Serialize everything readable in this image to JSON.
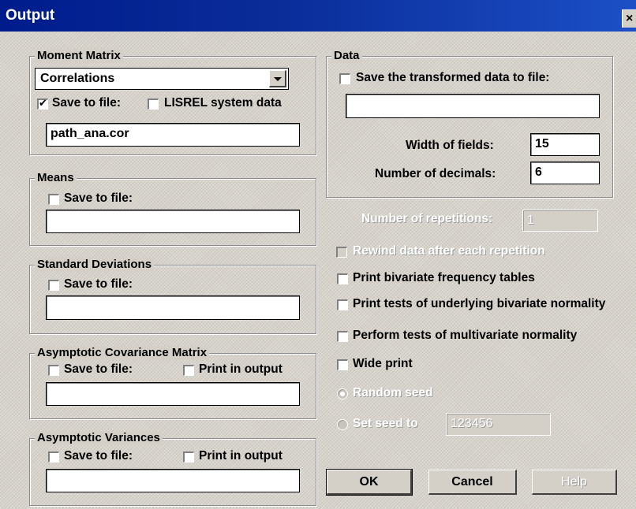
{
  "window": {
    "title": "Output",
    "close_glyph": "×"
  },
  "moment_matrix": {
    "title": "Moment Matrix",
    "select_value": "Correlations",
    "save_label": "Save to file:",
    "save_checked": true,
    "lisrel_label": "LISREL system data",
    "lisrel_checked": false,
    "file_value": "path_ana.cor"
  },
  "means": {
    "title": "Means",
    "save_label": "Save to file:",
    "file_value": ""
  },
  "std_dev": {
    "title": "Standard Deviations",
    "save_label": "Save to file:",
    "file_value": ""
  },
  "acm": {
    "title": "Asymptotic Covariance Matrix",
    "save_label": "Save to file:",
    "print_label": "Print in output",
    "file_value": ""
  },
  "av": {
    "title": "Asymptotic Variances",
    "save_label": "Save to file:",
    "print_label": "Print in output",
    "file_value": ""
  },
  "data": {
    "title": "Data",
    "save_label": "Save the transformed data to file:",
    "file_value": "",
    "width_label": "Width of fields:",
    "width_value": "15",
    "decimals_label": "Number of decimals:",
    "decimals_value": "6"
  },
  "options": {
    "repetitions_label": "Number of repetitions:",
    "repetitions_value": "1",
    "rewind_label": "Rewind data after each repetition",
    "bivariate_freq_label": "Print bivariate frequency tables",
    "bivariate_norm_label": "Print tests of underlying bivariate normality",
    "multivariate_label": "Perform tests of multivariate normality",
    "wide_print_label": "Wide print",
    "random_seed_label": "Random seed",
    "set_seed_label": "Set seed to",
    "seed_value": "123456"
  },
  "buttons": {
    "ok": "OK",
    "cancel": "Cancel",
    "help": "Help"
  }
}
